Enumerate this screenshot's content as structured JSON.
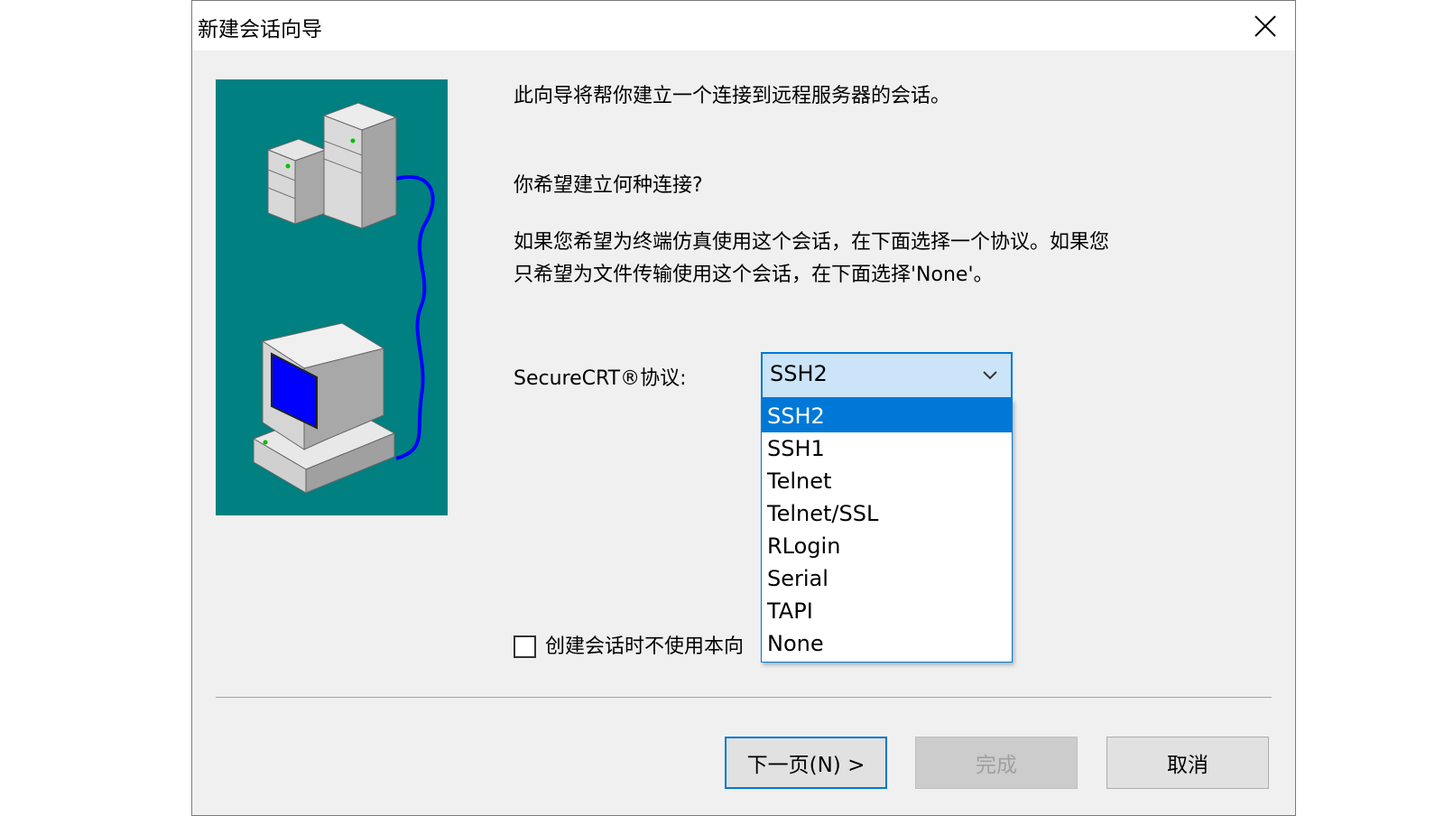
{
  "window": {
    "title": "新建会话向导",
    "close_icon": "close-icon"
  },
  "content": {
    "intro": "此向导将帮你建立一个连接到远程服务器的会话。",
    "question": "你希望建立何种连接?",
    "explain_line1": "如果您希望为终端仿真使用这个会话，在下面选择一个协议。如果您",
    "explain_line2": "只希望为文件传输使用这个会话，在下面选择'None'。",
    "protocol_label": "SecureCRT®协议:",
    "checkbox_label": "创建会话时不使用本向"
  },
  "protocol_select": {
    "value": "SSH2",
    "options": [
      "SSH2",
      "SSH1",
      "Telnet",
      "Telnet/SSL",
      "RLogin",
      "Serial",
      "TAPI",
      "None"
    ],
    "highlighted": "SSH2"
  },
  "buttons": {
    "next": "下一页(N) >",
    "finish": "完成",
    "cancel": "取消"
  },
  "colors": {
    "illustration_bg": "#008080",
    "accent": "#0078d7",
    "select_bg": "#cce4f7",
    "dialog_bg": "#f0f0f0"
  }
}
